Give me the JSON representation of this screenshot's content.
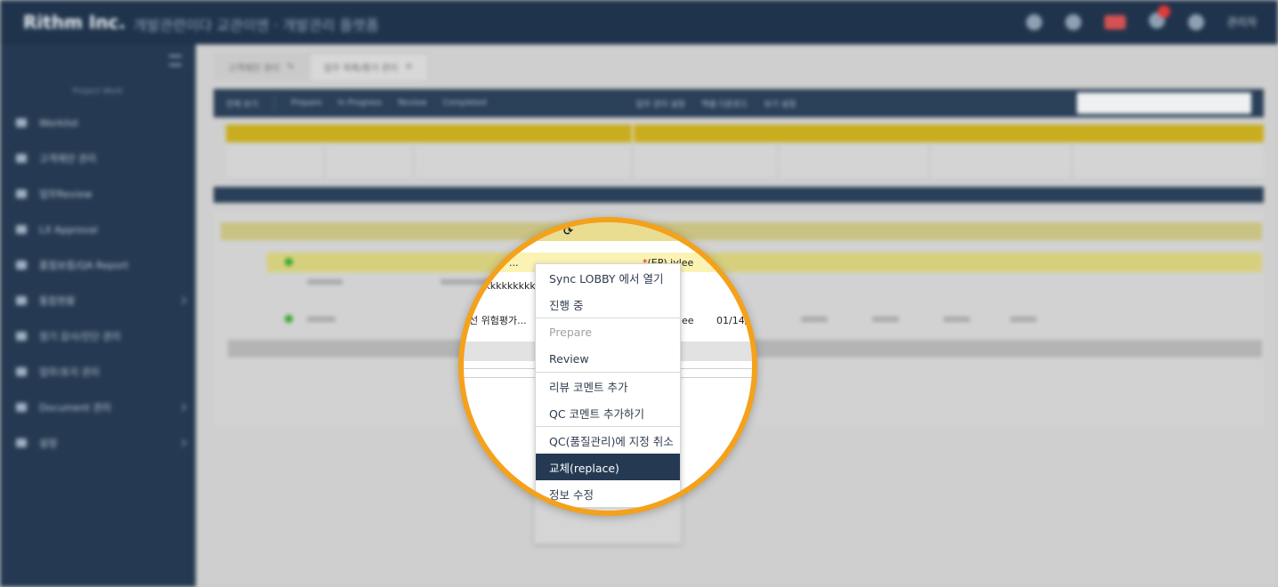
{
  "header": {
    "brand": "Rithm Inc.",
    "breadcrumb": "개발관련이다 교관이엔 · 개발관리 플랫폼",
    "user": "관리자"
  },
  "sidebar": {
    "project_label": "Project Work",
    "items": [
      {
        "label": "Worklist"
      },
      {
        "label": "고객제안 관리"
      },
      {
        "label": "업무Review"
      },
      {
        "label": "LX Approval"
      },
      {
        "label": "품질보증/QA Report"
      },
      {
        "label": "통합현황"
      },
      {
        "label": "정기 감사/진단 관리"
      },
      {
        "label": "업무/포지 관리"
      },
      {
        "label": "Document 관리"
      },
      {
        "label": "설정"
      }
    ]
  },
  "tabs": [
    {
      "label": "고객제안 관리"
    },
    {
      "label": "업무 목록/평가 관리"
    }
  ],
  "toolbar": {
    "items": [
      "전체 보기",
      "Prepare",
      "In Progress",
      "Review",
      "Completed"
    ],
    "right": [
      "업무 관리 설정",
      "엑셀 다운로드",
      "보기 설정"
    ]
  },
  "magnifier": {
    "sync_icon": "sync-icon",
    "row1": {
      "owner_star": "*",
      "owner": "(EP) jylee",
      "title": "..."
    },
    "row2": {
      "code": "kkkkkkkkkk"
    },
    "row3": {
      "title": "선 위험평가...",
      "owner": "ee",
      "date": "01/14/"
    }
  },
  "context_menu": {
    "items": [
      {
        "label": "Sync LOBBY 에서 열기",
        "state": "normal"
      },
      {
        "label": "진행 중",
        "state": "normal"
      },
      {
        "label": "Prepare",
        "state": "disabled"
      },
      {
        "label": "Review",
        "state": "normal"
      },
      {
        "label": "리뷰 코멘트 추가",
        "state": "normal"
      },
      {
        "label": "QC 코멘트 추가하기",
        "state": "normal"
      },
      {
        "label": "QC(품질관리)에 지정 취소",
        "state": "normal"
      },
      {
        "label": "교체(replace)",
        "state": "selected"
      },
      {
        "label": "정보 수정",
        "state": "normal"
      }
    ]
  },
  "colors": {
    "nav": "#253a52",
    "accent": "#f4a11c",
    "highlight": "#fbf3b4"
  }
}
